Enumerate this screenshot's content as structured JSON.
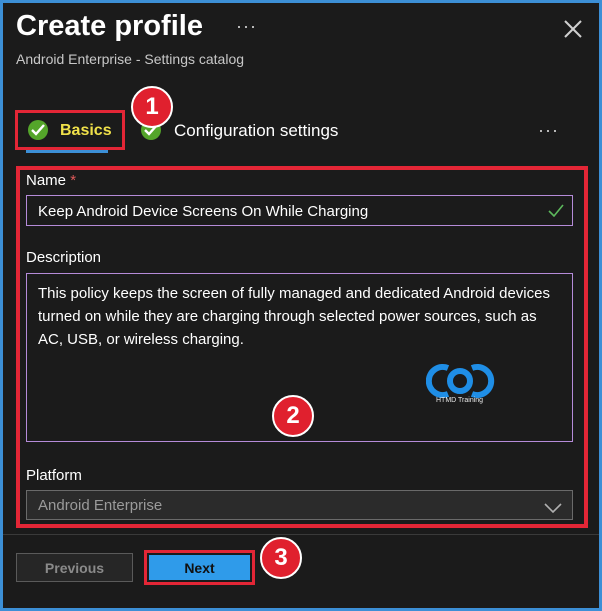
{
  "header": {
    "title": "Create profile",
    "more_label": "···",
    "subtitle": "Android Enterprise - Settings catalog",
    "close_icon": "close-icon"
  },
  "tabs": [
    {
      "label": "Basics",
      "status": "completed",
      "selected": true
    },
    {
      "label": "Configuration settings",
      "status": "completed",
      "selected": false
    }
  ],
  "tabs_more_label": "···",
  "form": {
    "name": {
      "label": "Name",
      "required_marker": "*",
      "value": "Keep Android Device Screens On While Charging",
      "valid": true
    },
    "description": {
      "label": "Description",
      "value": "This policy keeps the screen of fully managed and dedicated Android devices turned on while they are charging through selected power sources, such as AC, USB, or wireless charging."
    },
    "platform": {
      "label": "Platform",
      "value": "Android Enterprise"
    }
  },
  "watermark": {
    "text": "HTMD Training"
  },
  "footer": {
    "previous_label": "Previous",
    "next_label": "Next"
  },
  "callouts": [
    "1",
    "2",
    "3"
  ],
  "colors": {
    "background": "#1b1b1b",
    "frame": "#3c8fd6",
    "highlight": "#e32636",
    "check": "#54a52a",
    "selected_tab_text": "#f0e14a",
    "primary_button": "#2f9bea",
    "input_border": "#b58bd9"
  }
}
